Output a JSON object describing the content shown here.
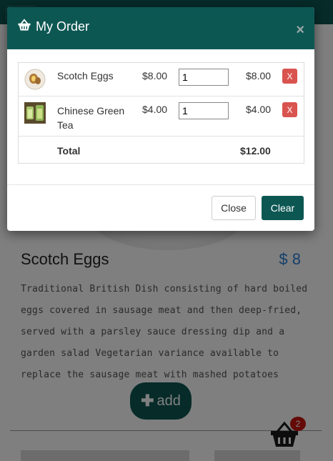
{
  "product": {
    "name": "Scotch Eggs",
    "price": "$ 8",
    "description": "Traditional British Dish consisting of hard boiled eggs covered in sausage meat and then deep-fried, served with a parsley sauce dressing dip and a garden salad Vegetarian variance available to replace the sausage meat with mashed potatoes",
    "add_label": "add"
  },
  "cart": {
    "count": "2"
  },
  "modal": {
    "title": "My Order",
    "close_symbol": "×",
    "items": [
      {
        "name": "Scotch Eggs",
        "unit_price": "$8.00",
        "qty": "1",
        "line_total": "$8.00",
        "remove_label": "X"
      },
      {
        "name": "Chinese Green Tea",
        "unit_price": "$4.00",
        "qty": "1",
        "line_total": "$4.00",
        "remove_label": "X"
      }
    ],
    "total_label": "Total",
    "total_value": "$12.00",
    "close_button": "Close",
    "clear_button": "Clear"
  },
  "colors": {
    "brand": "#0d5753",
    "danger": "#d9534f",
    "price": "#2a7fd4",
    "badge": "#c9140f"
  }
}
